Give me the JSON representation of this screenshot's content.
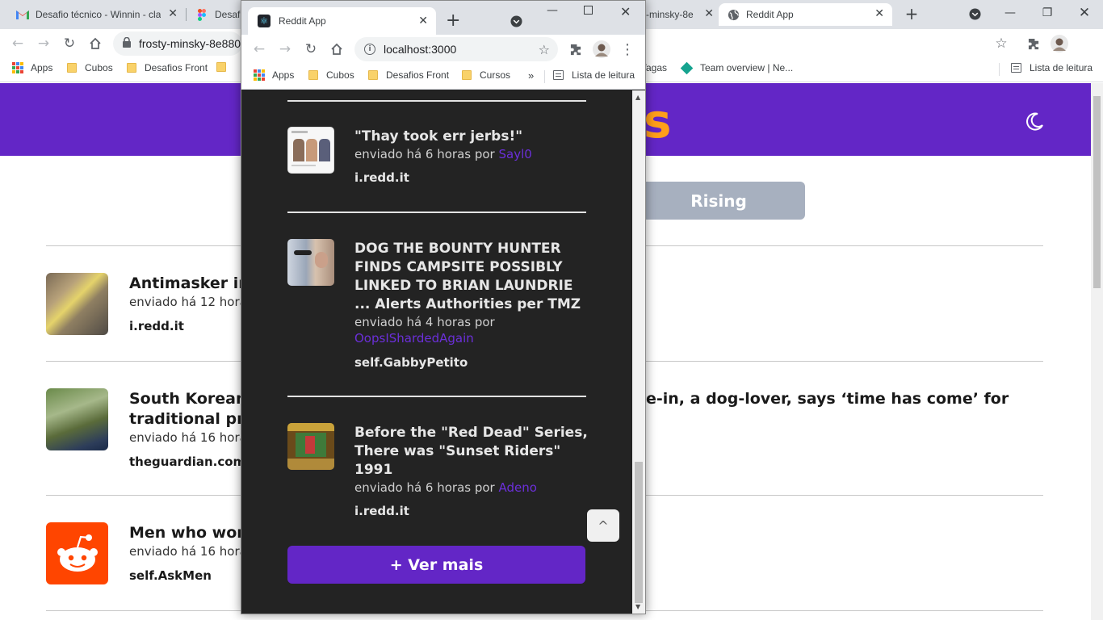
{
  "bg_browser": {
    "tabs": [
      {
        "title": "Desafio técnico - Winnin - cla",
        "icon": "gmail-icon"
      },
      {
        "title": "Desafi",
        "icon": "figma-icon"
      },
      {
        "title": "-minsky-8e",
        "icon": ""
      },
      {
        "title": "Reddit App",
        "icon": "globe-icon"
      }
    ],
    "address": "frosty-minsky-8e880",
    "bookmarks": {
      "apps": "Apps",
      "cubos": "Cubos",
      "desafios_front": "Desafios Front",
      "vagas": "Vagas",
      "team_overview": "Team overview | Ne...",
      "reading_list": "Lista de leitura"
    }
  },
  "bg_page": {
    "rising_label": "Rising",
    "posts": [
      {
        "title": "Antimasker in",
        "meta": "enviado há 12 hora",
        "domain": "i.redd.it"
      },
      {
        "title": "South Korean p",
        "title_rest": "e-in, a dog-lover, says ‘time has come’ for",
        "title_line2": "traditional pra",
        "meta": "enviado há 16 hora",
        "domain": "theguardian.com"
      },
      {
        "title": "Men who work",
        "meta": "enviado há 16 hora",
        "domain": "self.AskMen"
      }
    ]
  },
  "fg_browser": {
    "tab_title": "Reddit App",
    "address": "localhost:3000",
    "bookmarks": {
      "apps": "Apps",
      "cubos": "Cubos",
      "desafios_front": "Desafios Front",
      "cursos": "Cursos",
      "overflow": "»",
      "reading_list": "Lista de leitura"
    }
  },
  "fg_page": {
    "posts": [
      {
        "title": "\"Thay took err jerbs!\"",
        "meta_prefix": "enviado há 6 horas por ",
        "author": "Sayl0",
        "domain": "i.redd.it"
      },
      {
        "title": "DOG THE BOUNTY HUNTER FINDS CAMPSITE POSSIBLY LINKED TO BRIAN LAUNDRIE ... Alerts Authorities per TMZ",
        "meta_prefix": "enviado há 4 horas por ",
        "author": "OopsIShardedAgain",
        "domain": "self.GabbyPetito"
      },
      {
        "title": "Before the \"Red Dead\" Series, There was \"Sunset Riders\" 1991",
        "meta_prefix": "enviado há 6 horas por ",
        "author": "Adeno",
        "domain": "i.redd.it"
      }
    ],
    "back_to_top": "^",
    "see_more": "+ Ver mais"
  },
  "colors": {
    "brand_purple": "#6326c6",
    "logo_orange": "#ff9f1a",
    "dark_bg": "#232323"
  }
}
